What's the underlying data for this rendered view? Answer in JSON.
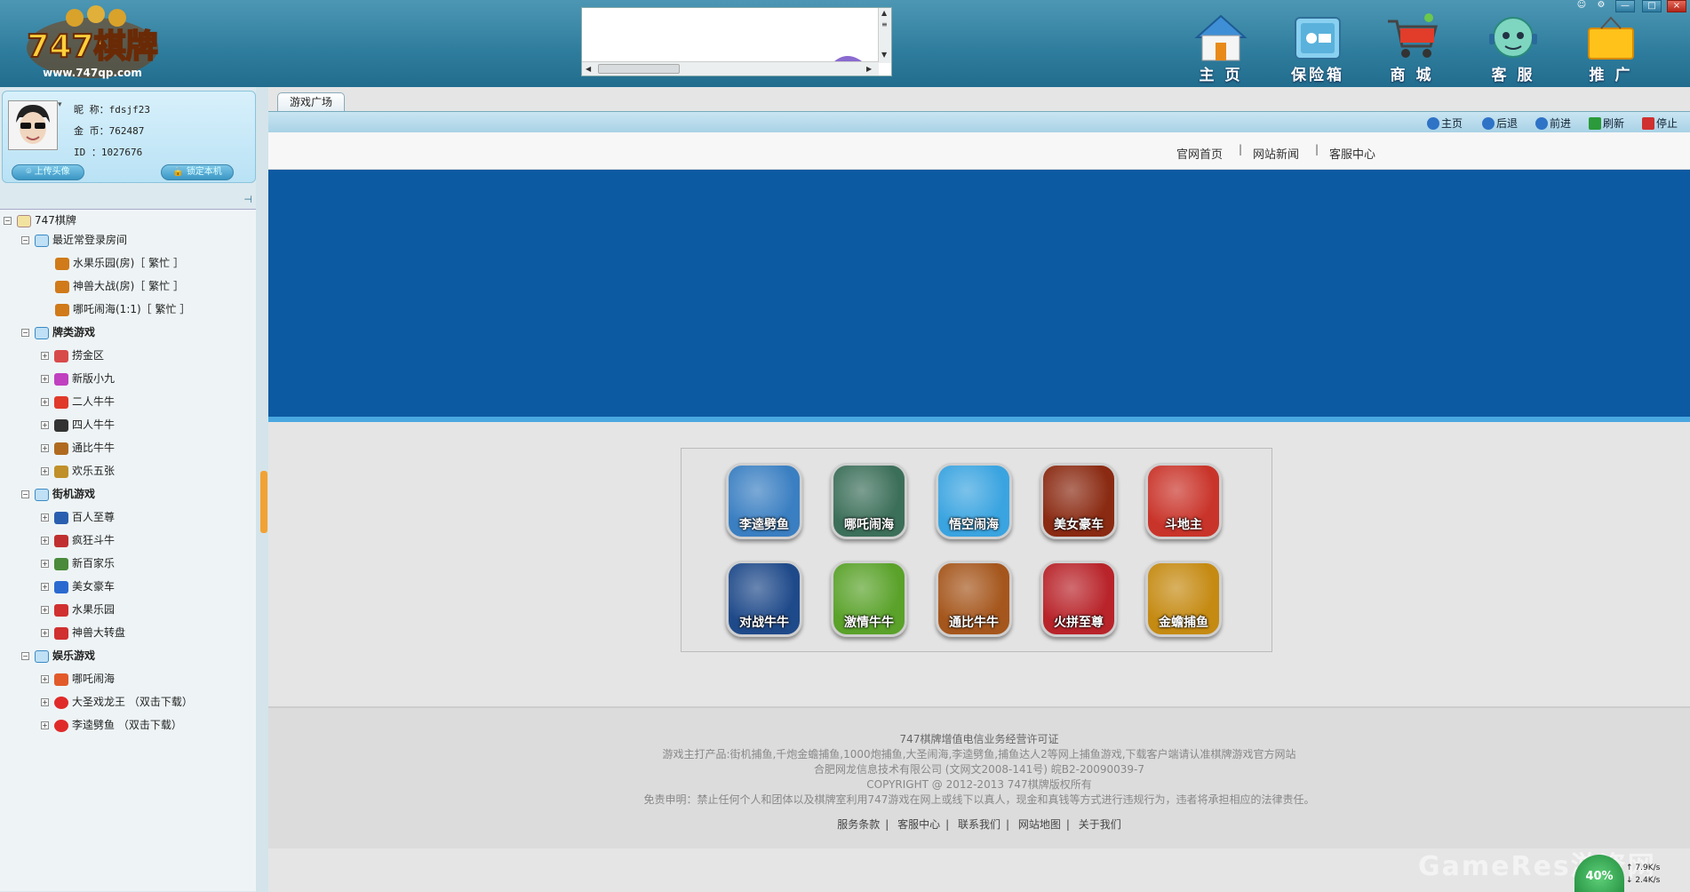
{
  "header": {
    "logo_text": "747棋牌",
    "logo_url": "www.747qp.com",
    "nav": [
      {
        "label": "主 页",
        "icon": "home-icon"
      },
      {
        "label": "保险箱",
        "icon": "safe-icon"
      },
      {
        "label": "商 城",
        "icon": "cart-icon"
      },
      {
        "label": "客 服",
        "icon": "support-icon"
      },
      {
        "label": "推 广",
        "icon": "promote-icon"
      }
    ],
    "window_controls": [
      "—",
      "□",
      "×"
    ]
  },
  "user": {
    "nickname_label": "昵 称：",
    "nickname": "fdsjf23",
    "coins_label": "金 币：",
    "coins": "762487",
    "id_label": "ID   ：",
    "id": "1027676",
    "upload_btn": "上传头像",
    "lock_btn": "锁定本机"
  },
  "tree": {
    "root": "747棋牌",
    "groups": [
      {
        "name": "最近常登录房间",
        "bold": false,
        "items": [
          {
            "label": "水果乐园(房)［ 繁忙 ］"
          },
          {
            "label": "神兽大战(房)［ 繁忙 ］"
          },
          {
            "label": "哪吒闹海(1:1)［ 繁忙 ］"
          }
        ]
      },
      {
        "name": "牌类游戏",
        "bold": true,
        "items": [
          {
            "label": "捞金区"
          },
          {
            "label": "新版小九"
          },
          {
            "label": "二人牛牛"
          },
          {
            "label": "四人牛牛"
          },
          {
            "label": "通比牛牛"
          },
          {
            "label": "欢乐五张"
          }
        ]
      },
      {
        "name": "街机游戏",
        "bold": true,
        "items": [
          {
            "label": "百人至尊"
          },
          {
            "label": "疯狂斗牛"
          },
          {
            "label": "新百家乐"
          },
          {
            "label": "美女豪车"
          },
          {
            "label": "水果乐园"
          },
          {
            "label": "神兽大转盘"
          }
        ]
      },
      {
        "name": "娱乐游戏",
        "bold": true,
        "items": [
          {
            "label": "哪吒闹海"
          },
          {
            "label": "大圣戏龙王 （双击下载）"
          },
          {
            "label": "李逵劈鱼 （双击下载）"
          }
        ]
      }
    ]
  },
  "main": {
    "tab": "游戏广场",
    "toolbar": [
      {
        "label": "主页",
        "color": "#2f73c7"
      },
      {
        "label": "后退",
        "color": "#2f73c7"
      },
      {
        "label": "前进",
        "color": "#2f73c7"
      },
      {
        "label": "刷新",
        "color": "#2a9a3a"
      },
      {
        "label": "停止",
        "color": "#d03030"
      }
    ],
    "links": [
      "官网首页",
      "网站新闻",
      "客服中心"
    ],
    "games": [
      {
        "label": "李逵劈鱼",
        "bg": "#3a7fc2"
      },
      {
        "label": "哪吒闹海",
        "bg": "#3c6f5a"
      },
      {
        "label": "悟空闹海",
        "bg": "#3aa4e0"
      },
      {
        "label": "美女豪车",
        "bg": "#8a2a12"
      },
      {
        "label": "斗地主",
        "bg": "#c9342a"
      },
      {
        "label": "对战牛牛",
        "bg": "#1f4a8a"
      },
      {
        "label": "激情牛牛",
        "bg": "#5aa22a"
      },
      {
        "label": "通比牛牛",
        "bg": "#a5561c"
      },
      {
        "label": "火拼至尊",
        "bg": "#b8242a"
      },
      {
        "label": "金蟾捕鱼",
        "bg": "#c58a12"
      }
    ]
  },
  "footer": {
    "license": "747棋牌增值电信业务经营许可证",
    "products": "游戏主打产品:街机捕鱼,千炮金蟾捕鱼,1000炮捕鱼,大圣闹海,李逵劈鱼,捕鱼达人2等网上捕鱼游戏,下载客户端请认准棋牌游戏官方网站",
    "company": "合肥网龙信息技术有限公司 (文网文2008-141号) 皖B2-20090039-7",
    "copyright": "COPYRIGHT @ 2012-2013 747棋牌版权所有",
    "disclaimer": "免责申明：禁止任何个人和团体以及棋牌室利用747游戏在网上或线下以真人，现金和真钱等方式进行违规行为，违者将承担相应的法律责任。",
    "nav": [
      "服务条款",
      "客服中心",
      "联系我们",
      "网站地图",
      "关于我们"
    ]
  },
  "watermark": "GameRes游资网",
  "speed": {
    "percent": "40%",
    "up": "7.9K/s",
    "down": "2.4K/s"
  }
}
